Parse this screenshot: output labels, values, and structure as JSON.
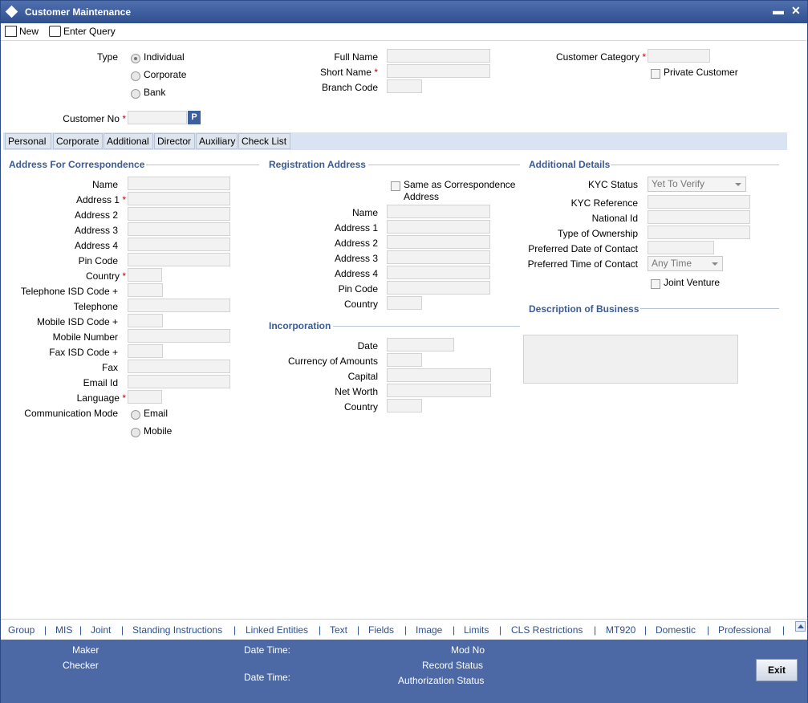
{
  "window": {
    "title": "Customer Maintenance",
    "minimize": "▬",
    "close": "✕"
  },
  "toolbar": {
    "new_label": "New",
    "enter_query_label": "Enter Query"
  },
  "header": {
    "type_label": "Type",
    "type_options": [
      "Individual",
      "Corporate",
      "Bank"
    ],
    "full_name_label": "Full Name",
    "short_name_label": "Short Name",
    "branch_code_label": "Branch Code",
    "customer_category_label": "Customer Category",
    "private_customer_label": "Private Customer",
    "customer_no_label": "Customer No",
    "pick_button": "P",
    "required_mark": "*"
  },
  "tabs": [
    "Personal",
    "Corporate",
    "Additional",
    "Director",
    "Auxiliary",
    "Check List"
  ],
  "correspondence": {
    "title": "Address For Correspondence",
    "fields": {
      "name": "Name",
      "address1": "Address 1",
      "address2": "Address 2",
      "address3": "Address 3",
      "address4": "Address 4",
      "pin_code": "Pin Code",
      "country": "Country",
      "telephone_isd": "Telephone ISD Code +",
      "telephone": "Telephone",
      "mobile_isd": "Mobile ISD Code +",
      "mobile_number": "Mobile Number",
      "fax_isd": "Fax ISD Code +",
      "fax": "Fax",
      "email_id": "Email Id",
      "language": "Language",
      "communication_mode": "Communication Mode"
    },
    "comm_options": [
      "Email",
      "Mobile"
    ]
  },
  "registration": {
    "title": "Registration Address",
    "same_as_label_1": "Same as Correspondence",
    "same_as_label_2": "Address",
    "fields": {
      "name": "Name",
      "address1": "Address 1",
      "address2": "Address 2",
      "address3": "Address 3",
      "address4": "Address 4",
      "pin_code": "Pin Code",
      "country": "Country"
    }
  },
  "incorporation": {
    "title": "Incorporation",
    "fields": {
      "date": "Date",
      "currency": "Currency of Amounts",
      "capital": "Capital",
      "net_worth": "Net Worth",
      "country": "Country"
    }
  },
  "additional": {
    "title": "Additional Details",
    "kyc_status_label": "KYC Status",
    "kyc_status_value": "Yet To Verify",
    "kyc_reference_label": "KYC Reference",
    "national_id_label": "National Id",
    "type_of_ownership_label": "Type of Ownership",
    "preferred_date_label": "Preferred Date of Contact",
    "preferred_time_label": "Preferred Time of Contact",
    "preferred_time_value": "Any Time",
    "joint_venture_label": "Joint Venture"
  },
  "business": {
    "title": "Description of Business"
  },
  "links": [
    "Group",
    "MIS",
    "Joint",
    "Standing Instructions",
    "Linked Entities",
    "Text",
    "Fields",
    "Image",
    "Limits",
    "CLS Restrictions",
    "MT920",
    "Domestic",
    "Professional"
  ],
  "footer": {
    "maker": "Maker",
    "checker": "Checker",
    "date_time_1": "Date Time:",
    "date_time_2": "Date Time:",
    "mod_no": "Mod No",
    "record_status": "Record Status",
    "authorization_status": "Authorization Status",
    "exit": "Exit"
  }
}
